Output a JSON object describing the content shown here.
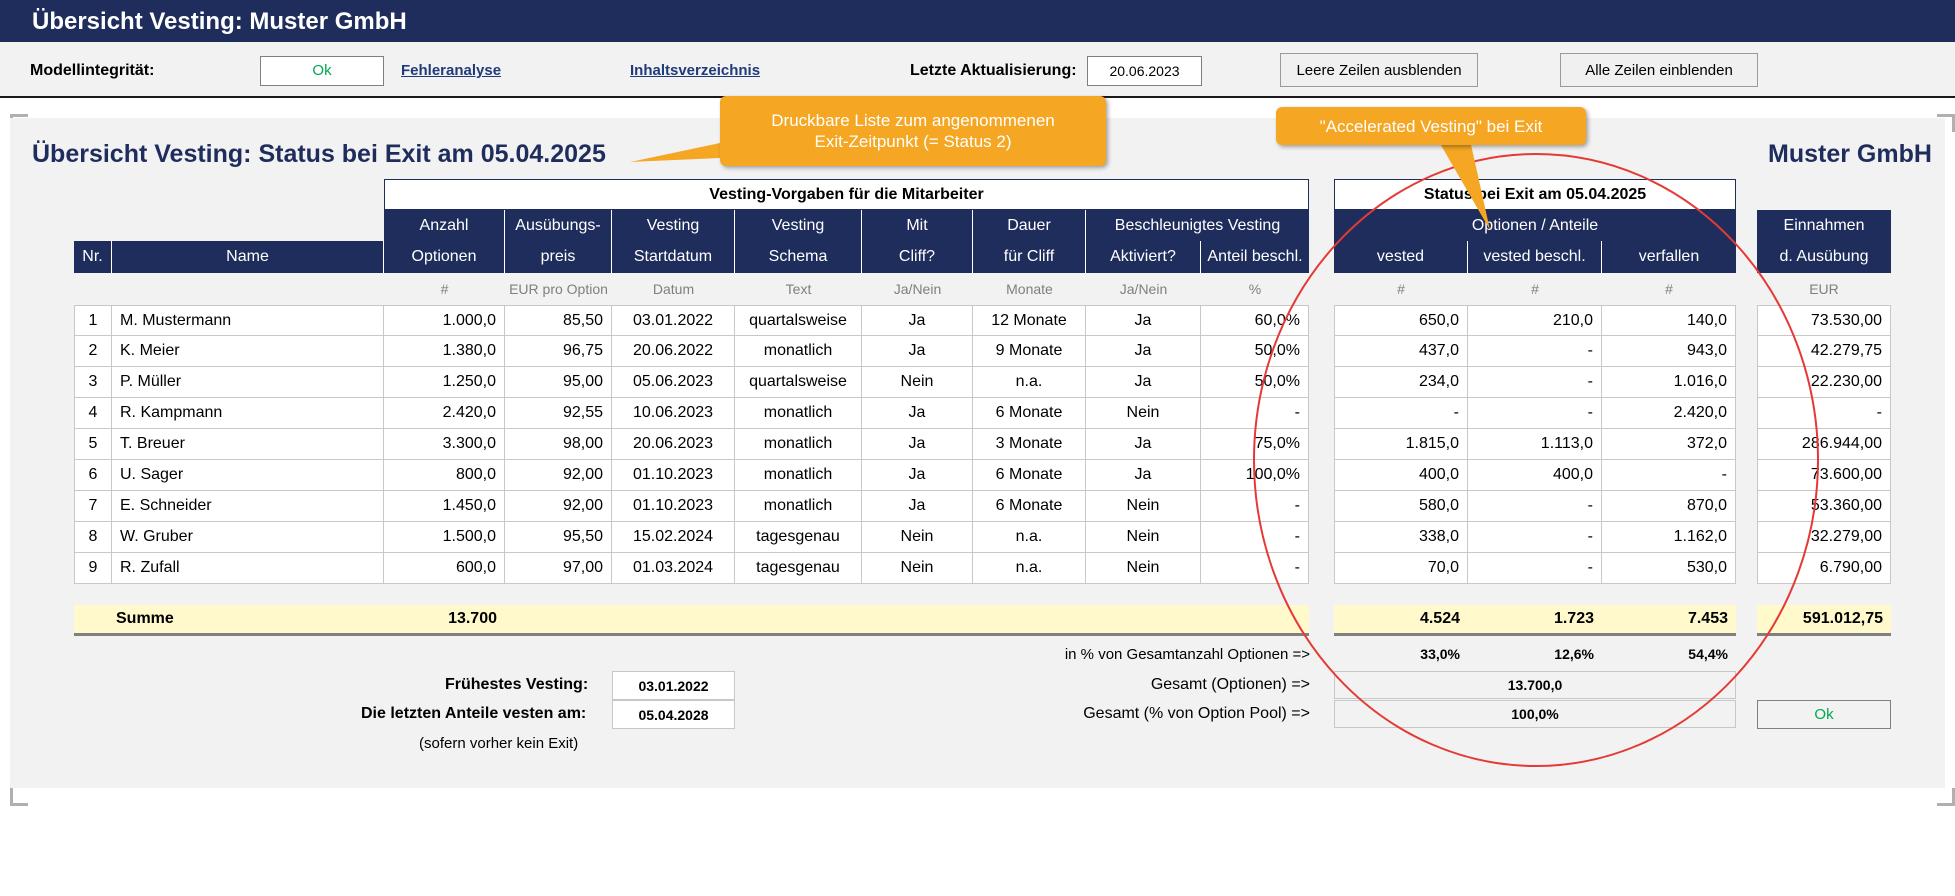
{
  "titlebar": {
    "title": "Übersicht Vesting: Muster GmbH"
  },
  "toolbar": {
    "model_integrity_label": "Modellintegrität:",
    "model_integrity_value": "Ok",
    "error_analysis_link": "Fehleranalyse",
    "contents_link": "Inhaltsverzeichnis",
    "last_update_label": "Letzte Aktualisierung:",
    "last_update_value": "20.06.2023",
    "hide_empty_rows_button": "Leere Zeilen ausblenden",
    "show_all_rows_button": "Alle Zeilen einblenden"
  },
  "sheet": {
    "heading": "Übersicht Vesting: Status bei Exit am 05.04.2025",
    "company": "Muster GmbH"
  },
  "callouts": {
    "printable_list": [
      "Druckbare Liste zum angenommenen",
      "Exit-Zeitpunkt (= Status 2)"
    ],
    "accelerated": "\"Accelerated Vesting\" bei Exit"
  },
  "colors": {
    "header_bg": "#1f2d5c",
    "sum_bg": "#fff9cc",
    "ok_green": "#00a651",
    "callout": "#f5a623",
    "circle": "#e53935"
  },
  "table": {
    "group_vorgaben": "Vesting-Vorgaben für die Mitarbeiter",
    "group_status": "Status bei Exit am 05.04.2025",
    "group_optionen": "Optionen / Anteile",
    "group_beschl": "Beschleunigtes Vesting",
    "headers": {
      "nr": "Nr.",
      "name": "Name",
      "anzahl": [
        "Anzahl",
        "Optionen"
      ],
      "preis": [
        "Ausübungs-",
        "preis"
      ],
      "start": [
        "Vesting",
        "Startdatum"
      ],
      "schema": [
        "Vesting",
        "Schema"
      ],
      "cliff": [
        "Mit",
        "Cliff?"
      ],
      "dauer": [
        "Dauer",
        "für Cliff"
      ],
      "aktiviert": "Aktiviert?",
      "anteil": "Anteil beschl.",
      "vested": "vested",
      "vested_beschl": "vested beschl.",
      "verfallen": "verfallen",
      "einnahmen": [
        "Einnahmen",
        "d. Ausübung"
      ]
    },
    "units": {
      "anzahl": "#",
      "preis": "EUR pro Option",
      "start": "Datum",
      "schema": "Text",
      "cliff": "Ja/Nein",
      "dauer": "Monate",
      "aktiviert": "Ja/Nein",
      "anteil": "%",
      "vested": "#",
      "vested_beschl": "#",
      "verfallen": "#",
      "einnahmen": "EUR"
    },
    "rows": [
      {
        "nr": "1",
        "name": "M. Mustermann",
        "anzahl": "1.000,0",
        "preis": "85,50",
        "start": "03.01.2022",
        "schema": "quartalsweise",
        "cliff": "Ja",
        "dauer": "12 Monate",
        "aktiviert": "Ja",
        "anteil": "60,0%",
        "vested": "650,0",
        "vested_beschl": "210,0",
        "verfallen": "140,0",
        "einnahmen": "73.530,00"
      },
      {
        "nr": "2",
        "name": "K. Meier",
        "anzahl": "1.380,0",
        "preis": "96,75",
        "start": "20.06.2022",
        "schema": "monatlich",
        "cliff": "Ja",
        "dauer": "9 Monate",
        "aktiviert": "Ja",
        "anteil": "50,0%",
        "vested": "437,0",
        "vested_beschl": "-",
        "verfallen": "943,0",
        "einnahmen": "42.279,75"
      },
      {
        "nr": "3",
        "name": "P. Müller",
        "anzahl": "1.250,0",
        "preis": "95,00",
        "start": "05.06.2023",
        "schema": "quartalsweise",
        "cliff": "Nein",
        "dauer": "n.a.",
        "aktiviert": "Ja",
        "anteil": "50,0%",
        "vested": "234,0",
        "vested_beschl": "-",
        "verfallen": "1.016,0",
        "einnahmen": "22.230,00"
      },
      {
        "nr": "4",
        "name": "R. Kampmann",
        "anzahl": "2.420,0",
        "preis": "92,55",
        "start": "10.06.2023",
        "schema": "monatlich",
        "cliff": "Ja",
        "dauer": "6 Monate",
        "aktiviert": "Nein",
        "anteil": "-",
        "vested": "-",
        "vested_beschl": "-",
        "verfallen": "2.420,0",
        "einnahmen": "-"
      },
      {
        "nr": "5",
        "name": "T. Breuer",
        "anzahl": "3.300,0",
        "preis": "98,00",
        "start": "20.06.2023",
        "schema": "monatlich",
        "cliff": "Ja",
        "dauer": "3 Monate",
        "aktiviert": "Ja",
        "anteil": "75,0%",
        "vested": "1.815,0",
        "vested_beschl": "1.113,0",
        "verfallen": "372,0",
        "einnahmen": "286.944,00"
      },
      {
        "nr": "6",
        "name": "U. Sager",
        "anzahl": "800,0",
        "preis": "92,00",
        "start": "01.10.2023",
        "schema": "monatlich",
        "cliff": "Ja",
        "dauer": "6 Monate",
        "aktiviert": "Ja",
        "anteil": "100,0%",
        "vested": "400,0",
        "vested_beschl": "400,0",
        "verfallen": "-",
        "einnahmen": "73.600,00"
      },
      {
        "nr": "7",
        "name": "E. Schneider",
        "anzahl": "1.450,0",
        "preis": "92,00",
        "start": "01.10.2023",
        "schema": "monatlich",
        "cliff": "Ja",
        "dauer": "6 Monate",
        "aktiviert": "Nein",
        "anteil": "-",
        "vested": "580,0",
        "vested_beschl": "-",
        "verfallen": "870,0",
        "einnahmen": "53.360,00"
      },
      {
        "nr": "8",
        "name": "W. Gruber",
        "anzahl": "1.500,0",
        "preis": "95,50",
        "start": "15.02.2024",
        "schema": "tagesgenau",
        "cliff": "Nein",
        "dauer": "n.a.",
        "aktiviert": "Nein",
        "anteil": "-",
        "vested": "338,0",
        "vested_beschl": "-",
        "verfallen": "1.162,0",
        "einnahmen": "32.279,00"
      },
      {
        "nr": "9",
        "name": "R. Zufall",
        "anzahl": "600,0",
        "preis": "97,00",
        "start": "01.03.2024",
        "schema": "tagesgenau",
        "cliff": "Nein",
        "dauer": "n.a.",
        "aktiviert": "Nein",
        "anteil": "-",
        "vested": "70,0",
        "vested_beschl": "-",
        "verfallen": "530,0",
        "einnahmen": "6.790,00"
      }
    ],
    "summe": {
      "label": "Summe",
      "anzahl": "13.700",
      "vested": "4.524",
      "vested_beschl": "1.723",
      "verfallen": "7.453",
      "einnahmen": "591.012,75"
    },
    "percent": {
      "label": "in % von Gesamtanzahl Optionen =>",
      "vested": "33,0%",
      "vested_beschl": "12,6%",
      "verfallen": "54,4%"
    }
  },
  "footer": {
    "fruehestes_label": "Frühestes Vesting:",
    "fruehestes_value": "03.01.2022",
    "letzte_label": "Die letzten Anteile vesten am:",
    "letzte_value": "05.04.2028",
    "note": "(sofern vorher kein Exit)",
    "gesamt_opt_label": "Gesamt (Optionen) =>",
    "gesamt_opt_value": "13.700,0",
    "gesamt_pool_label": "Gesamt (% von Option Pool) =>",
    "gesamt_pool_value": "100,0%",
    "check_value": "Ok"
  }
}
